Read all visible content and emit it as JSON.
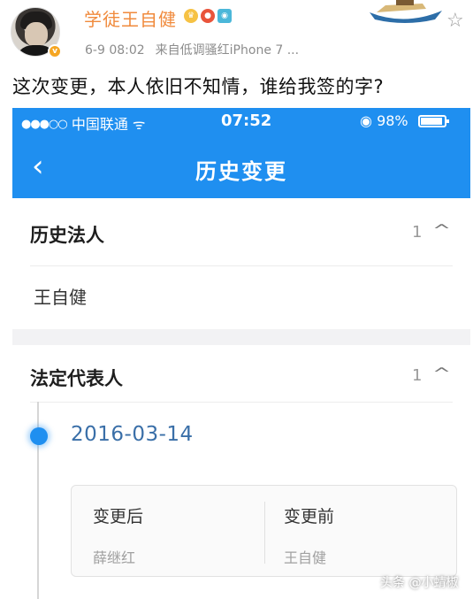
{
  "post": {
    "username": "学徒王自健",
    "verified_badge": "v",
    "user_badges": [
      "crown-icon",
      "level-badge-icon",
      "eye-icon"
    ],
    "date": "6-9 08:02",
    "source": "来自低调骚红iPhone 7 ...",
    "text": "这次变更，本人依旧不知情，谁给我签的字?",
    "colors": {
      "username": "#f08a3c",
      "meta": "#8c8c8c"
    }
  },
  "phone": {
    "status": {
      "signal_dots": "●●●○○",
      "carrier": "中国联通",
      "wifi_icon": "wifi-icon",
      "time": "07:52",
      "lock_icon": "orientation-lock-icon",
      "battery": "98%"
    },
    "nav": {
      "back_icon": "chevron-left-icon",
      "title": "历史变更",
      "bar_color": "#1f8ff0"
    },
    "sections": [
      {
        "title": "历史法人",
        "count": "1",
        "chevron": "chevron-up-icon",
        "items": [
          "王自健"
        ]
      },
      {
        "title": "法定代表人",
        "count": "1",
        "chevron": "chevron-up-icon",
        "timeline": [
          {
            "date": "2016-03-14",
            "after_label": "变更后",
            "after_value": "薛继红",
            "before_label": "变更前",
            "before_value": "王自健"
          }
        ]
      }
    ]
  },
  "watermark": "头条 @小蜻椒"
}
